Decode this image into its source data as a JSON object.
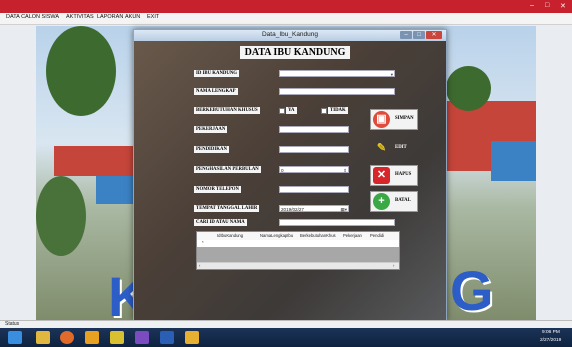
{
  "app": {
    "menu": [
      "DATA CALON SISWA",
      "AKTIVITAS",
      "LAPORAN",
      "AKUN",
      "EXIT"
    ],
    "window_controls": {
      "minimize": "–",
      "maximize": "□",
      "close": "✕"
    }
  },
  "background": {
    "letter_left": "K",
    "letter_right": "G"
  },
  "dialog": {
    "title": "Data_Ibu_Kandung",
    "heading": "DATA IBU KANDUNG",
    "labels": {
      "id": "ID IBU KANDUNG",
      "nama": "NAMA LENGKAP",
      "berkebutuhan": "BERKEBUTUHAN KHUSUS",
      "pekerjaan": "PEKERJAAN",
      "pendidikan": "PENDIDIKAN",
      "penghasilan": "PENGHASILAN PERBULAN",
      "telepon": "NOMOR TELEPON",
      "ttl": "TEMPAT TANGGAL LAHIR",
      "cari": "CARI ID ATAU NAMA"
    },
    "radio_ya": "YA",
    "radio_tidak": "TIDAK",
    "penghasilan_value": "0",
    "tanggal_value": "2019/02/27",
    "buttons": {
      "simpan": "SIMPAN",
      "edit": "EDIT",
      "hapus": "HAPUS",
      "batal": "BATAL"
    },
    "grid": {
      "columns": [
        "IdIbuKandung",
        "NamaLengkapIbu",
        "BerkebutuhanKhus",
        "Pekerjaan",
        "Pendidi"
      ],
      "new_row_marker": "*"
    }
  },
  "status": {
    "text": "Status"
  },
  "taskbar": {
    "time": "9:06 PM",
    "date": "2/27/2019"
  }
}
